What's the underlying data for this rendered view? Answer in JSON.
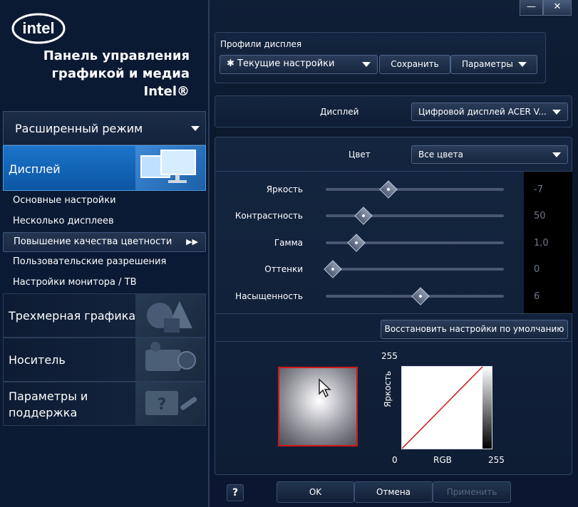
{
  "window": {
    "min_glyph": "—",
    "close_glyph": "✕"
  },
  "brand": {
    "logo": "intel",
    "line1": "Панель управления",
    "line2": "графикой и медиа",
    "line3": "Intel®"
  },
  "mode": {
    "label": "Расширенный режим"
  },
  "nav": {
    "display": "Дисплей",
    "subitems": [
      "Основные настройки",
      "Несколько дисплеев",
      "Повышение качества цветности",
      "Пользовательские разрешения",
      "Настройки монитора / ТВ"
    ],
    "selected_arrow": "▶▶",
    "graphics3d": "Трехмерная графика",
    "media": "Носитель",
    "support_line1": "Параметры и",
    "support_line2": "поддержка"
  },
  "profiles": {
    "title": "Профили дисплея",
    "current": "✱ Текущие настройки",
    "save": "Сохранить",
    "options": "Параметры"
  },
  "display": {
    "label": "Дисплей",
    "value": "Цифровой дисплей ACER V..."
  },
  "color": {
    "label": "Цвет",
    "value": "Все цвета"
  },
  "sliders": [
    {
      "name": "Яркость",
      "value": "-7",
      "fraction": 0.35
    },
    {
      "name": "Контрастность",
      "value": "50",
      "fraction": 0.21
    },
    {
      "name": "Гамма",
      "value": "1,0",
      "fraction": 0.17
    },
    {
      "name": "Оттенки",
      "value": "0",
      "fraction": 0.04
    },
    {
      "name": "Насыщенность",
      "value": "6",
      "fraction": 0.53
    }
  ],
  "restore": "Восстановить настройки по умолчанию",
  "graph": {
    "y_max": "255",
    "y_label": "Яркость",
    "x_min": "0",
    "x_label": "RGB",
    "x_max": "255"
  },
  "footer": {
    "help": "?",
    "ok": "OK",
    "cancel": "Отмена",
    "apply": "Применить"
  },
  "colors": {
    "accent": "#1a74c8",
    "curve": "#d01818",
    "preview_border": "#d01818"
  }
}
